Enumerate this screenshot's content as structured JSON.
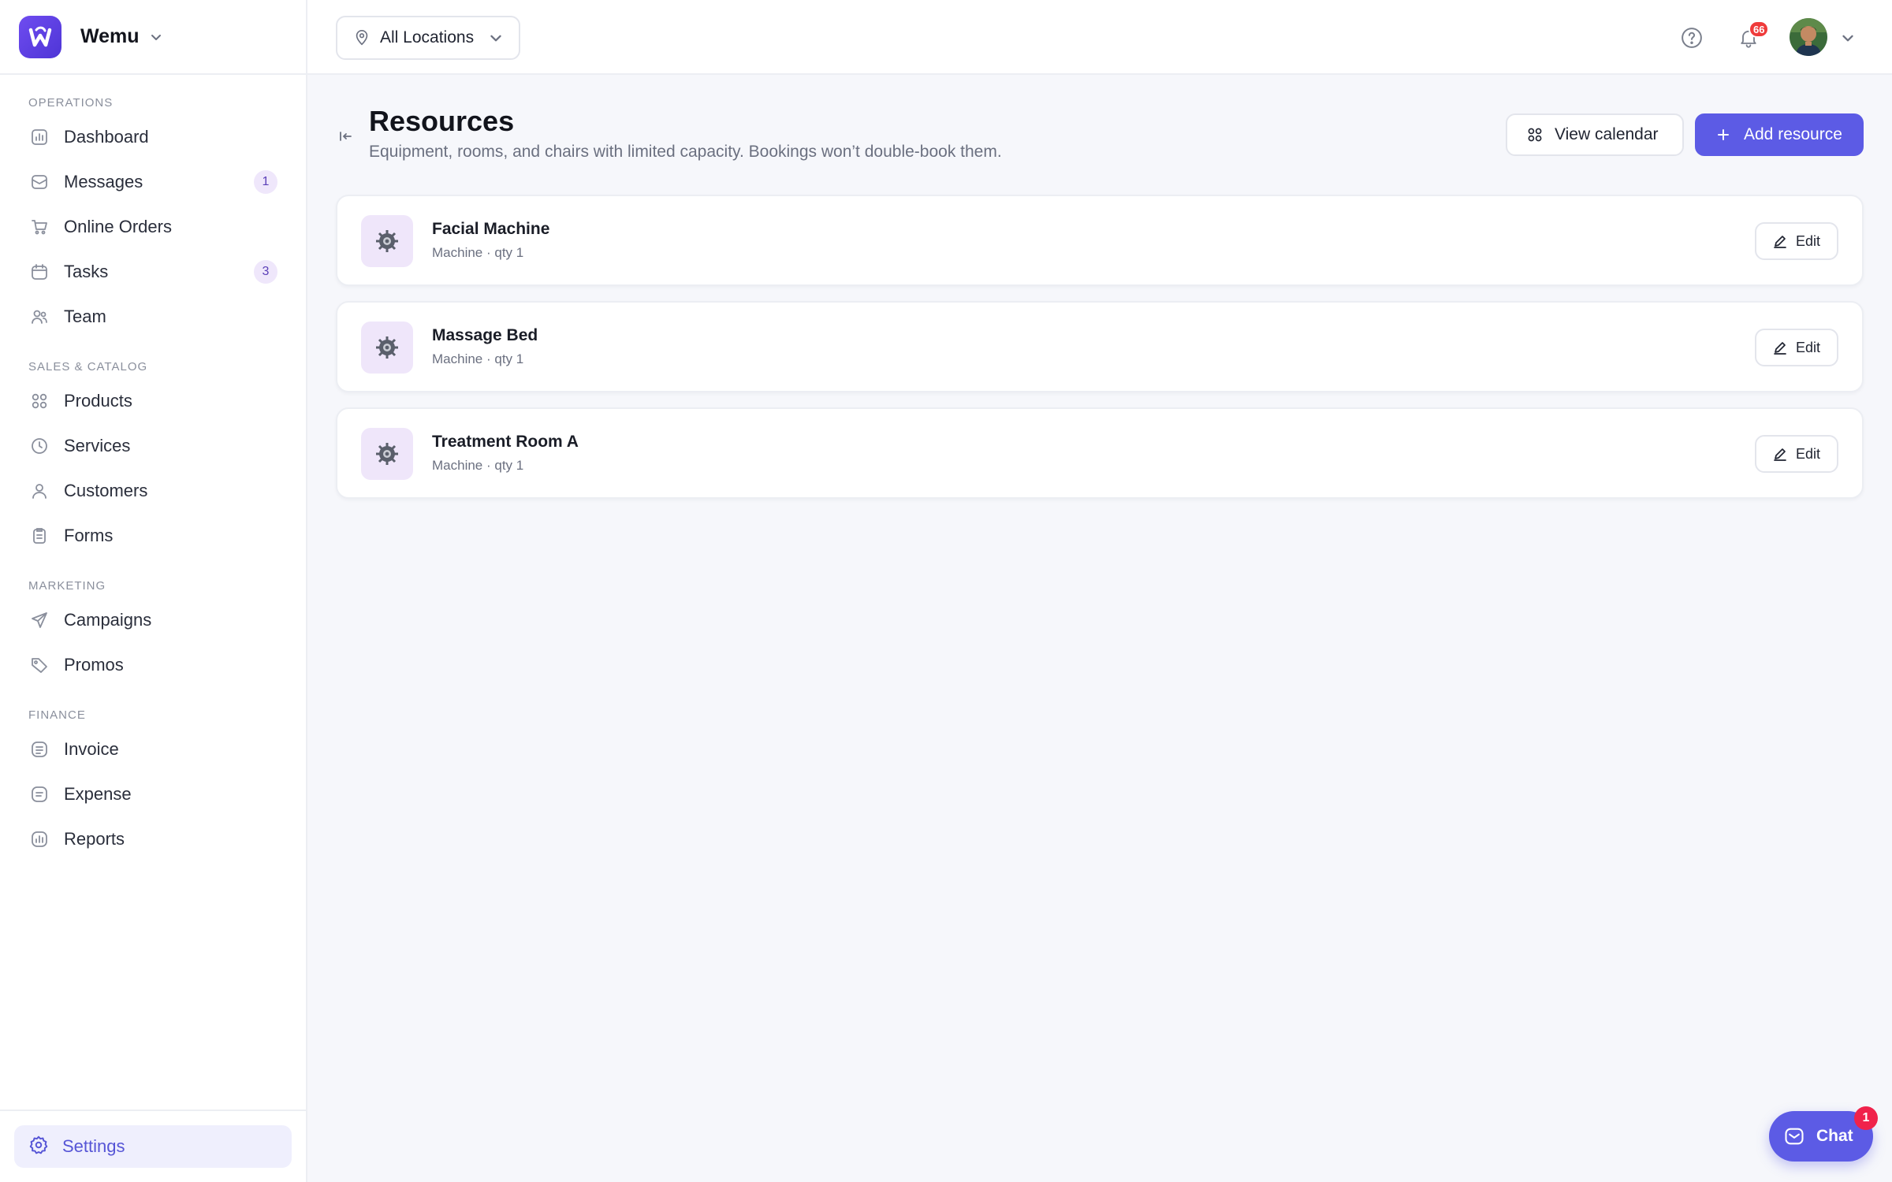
{
  "brand": {
    "name": "Wemu"
  },
  "sidebar": {
    "sections": [
      {
        "title": "OPERATIONS",
        "items": [
          {
            "label": "Dashboard",
            "icon": "chart-icon"
          },
          {
            "label": "Messages",
            "icon": "inbox-icon",
            "badge": "1"
          },
          {
            "label": "Online Orders",
            "icon": "cart-icon"
          },
          {
            "label": "Tasks",
            "icon": "calendar-icon",
            "badge": "3"
          },
          {
            "label": "Team",
            "icon": "users-icon"
          }
        ]
      },
      {
        "title": "SALES & CATALOG",
        "items": [
          {
            "label": "Products",
            "icon": "grid-icon"
          },
          {
            "label": "Services",
            "icon": "clock-icon"
          },
          {
            "label": "Customers",
            "icon": "user-icon"
          },
          {
            "label": "Forms",
            "icon": "clipboard-icon"
          }
        ]
      },
      {
        "title": "MARKETING",
        "items": [
          {
            "label": "Campaigns",
            "icon": "send-icon"
          },
          {
            "label": "Promos",
            "icon": "tag-icon"
          }
        ]
      },
      {
        "title": "FINANCE",
        "items": [
          {
            "label": "Invoice",
            "icon": "invoice-icon"
          },
          {
            "label": "Expense",
            "icon": "expense-icon"
          },
          {
            "label": "Reports",
            "icon": "chart-icon"
          }
        ]
      }
    ],
    "settings": {
      "label": "Settings",
      "icon": "gear-icon"
    }
  },
  "topbar": {
    "location": "All Locations",
    "notifications_count": "66"
  },
  "page": {
    "title": "Resources",
    "subtitle": "Equipment, rooms, and chairs with limited capacity. Bookings won’t double-book them.",
    "view_calendar": "View calendar",
    "add_resource": "Add resource"
  },
  "resources": [
    {
      "name": "Facial Machine",
      "meta": "Machine · qty 1",
      "edit": "Edit"
    },
    {
      "name": "Massage Bed",
      "meta": "Machine · qty 1",
      "edit": "Edit"
    },
    {
      "name": "Treatment Room A",
      "meta": "Machine · qty 1",
      "edit": "Edit"
    }
  ],
  "chat": {
    "label": "Chat",
    "badge": "1"
  },
  "colors": {
    "accent": "#5c5be5",
    "brand": "#5b3fe0",
    "badge_red": "#ef3b3b"
  }
}
